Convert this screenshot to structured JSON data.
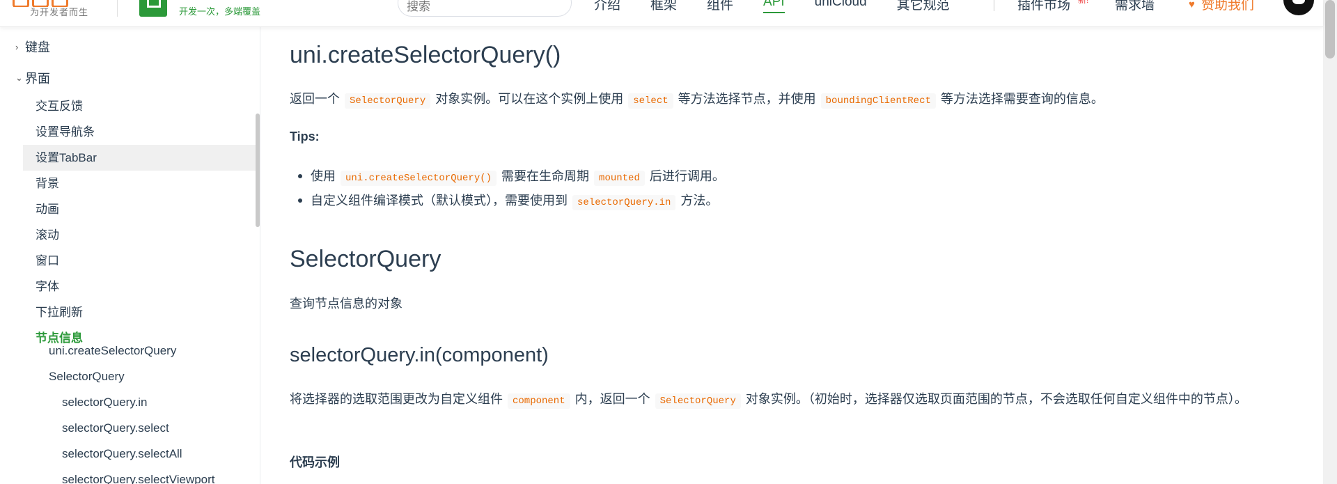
{
  "header": {
    "logo_slogan": "为开发者而生",
    "brand_tagline": "开发一次，多端覆盖",
    "search_placeholder": "搜索",
    "nav": [
      "介绍",
      "框架",
      "组件",
      "API",
      "uniCloud",
      "其它规范"
    ],
    "active_nav": "API",
    "plugin_market": "插件市场",
    "new_badge": "新!",
    "demand_wall": "需求墙",
    "sponsor": "赞助我们",
    "brand_color": "#2b9939",
    "accent_color": "#ef7a2b"
  },
  "sidebar": {
    "groups": [
      {
        "label": "键盘",
        "arrow": "›",
        "expanded": false
      },
      {
        "label": "界面",
        "arrow": "⌄",
        "expanded": true
      }
    ],
    "items": [
      "交互反馈",
      "设置导航条",
      "设置TabBar",
      "背景",
      "动画",
      "滚动",
      "窗口",
      "字体",
      "下拉刷新",
      "节点信息"
    ],
    "highlighted_item": "设置TabBar",
    "current_item": "节点信息",
    "sub_items": [
      "uni.createSelectorQuery",
      "SelectorQuery"
    ],
    "sub_sub_items": [
      "selectorQuery.in",
      "selectorQuery.select",
      "selectorQuery.selectAll",
      "selectorQuery.selectViewport"
    ]
  },
  "content": {
    "title": "uni.createSelectorQuery()",
    "intro": {
      "t1": "返回一个",
      "c1": "SelectorQuery",
      "t2": "对象实例。可以在这个实例上使用",
      "c2": "select",
      "t3": "等方法选择节点，并使用",
      "c3": "boundingClientRect",
      "t4": "等方法选择需要查询的信息。"
    },
    "tips_label": "Tips:",
    "tips": [
      {
        "t1": "使用",
        "c1": "uni.createSelectorQuery()",
        "t2": "需要在生命周期",
        "c2": "mounted",
        "t3": "后进行调用。"
      },
      {
        "t1": "自定义组件编译模式（默认模式），需要使用到",
        "c1": "selectorQuery.in",
        "t2": "方法。"
      }
    ],
    "section2_title": "SelectorQuery",
    "section2_desc": "查询节点信息的对象",
    "section3_title": "selectorQuery.in(component)",
    "section3_desc": {
      "t1": "将选择器的选取范围更改为自定义组件",
      "c1": "component",
      "t2": "内，返回一个",
      "c2": "SelectorQuery",
      "t3": "对象实例。（初始时，选择器仅选取页面范围的节点，不会选取任何自定义组件中的节点）。"
    },
    "code_example_label": "代码示例",
    "code_color": "#e96900"
  }
}
